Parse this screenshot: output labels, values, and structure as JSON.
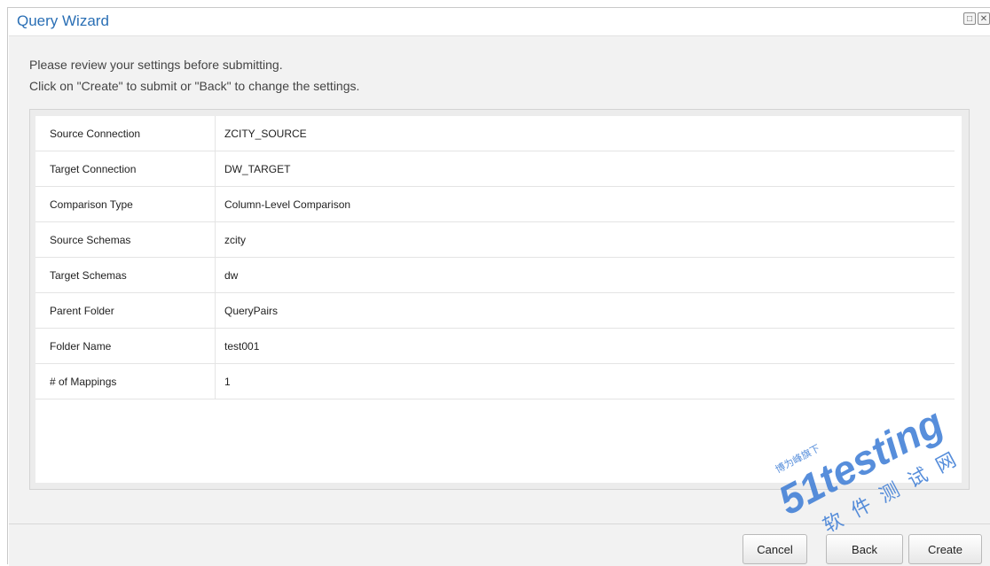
{
  "window": {
    "title": "Query Wizard",
    "restore_glyph": "□",
    "close_glyph": "✕"
  },
  "intro": {
    "line1": "Please review your settings before submitting.",
    "line2": "Click on \"Create\" to submit or \"Back\" to change the settings."
  },
  "summary": [
    {
      "label": "Source Connection",
      "value": "ZCITY_SOURCE"
    },
    {
      "label": "Target Connection",
      "value": "DW_TARGET"
    },
    {
      "label": "Comparison Type",
      "value": "Column-Level Comparison"
    },
    {
      "label": "Source Schemas",
      "value": "zcity"
    },
    {
      "label": "Target Schemas",
      "value": "dw"
    },
    {
      "label": "Parent Folder",
      "value": "QueryPairs"
    },
    {
      "label": "Folder Name",
      "value": "test001"
    },
    {
      "label": "# of Mappings",
      "value": "1"
    }
  ],
  "buttons": {
    "cancel": "Cancel",
    "back": "Back",
    "create": "Create"
  },
  "watermark": {
    "brand": "51testing",
    "cn_line": "软件测试网",
    "badge": "博为峰旗下"
  },
  "colors": {
    "title": "#2a6fb5",
    "watermark_blue": "#3a7bd5",
    "watermark_orange": "#f39c12"
  }
}
